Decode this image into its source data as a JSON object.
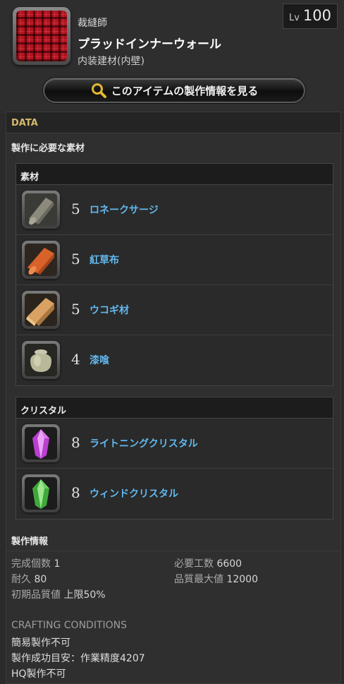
{
  "item": {
    "job": "裁縫師",
    "name": "プラッドインナーウォール",
    "category": "内装建材(内壁)",
    "level_label": "Lv",
    "level": "100",
    "icon": "red-plaid-fabric-icon"
  },
  "craft_button": {
    "label": "このアイテムの製作情報を見る",
    "icon": "magnifier-icon"
  },
  "data_section": {
    "title": "DATA",
    "materials_title": "製作に必要な素材",
    "materials_group": {
      "title": "素材",
      "items": [
        {
          "qty": "5",
          "name": "ロネークサージ",
          "icon": "cloth-roll-icon"
        },
        {
          "qty": "5",
          "name": "紅草布",
          "icon": "red-cloth-icon"
        },
        {
          "qty": "5",
          "name": "ウコギ材",
          "icon": "lumber-icon"
        },
        {
          "qty": "4",
          "name": "漆喰",
          "icon": "jar-icon"
        }
      ]
    },
    "crystals_group": {
      "title": "クリスタル",
      "items": [
        {
          "qty": "8",
          "name": "ライトニングクリスタル",
          "icon": "lightning-crystal-icon"
        },
        {
          "qty": "8",
          "name": "ウィンドクリスタル",
          "icon": "wind-crystal-icon"
        }
      ]
    },
    "craft_info": {
      "title": "製作情報",
      "yield_label": "完成個数",
      "yield": "1",
      "workload_label": "必要工数",
      "workload": "6600",
      "durability_label": "耐久",
      "durability": "80",
      "max_quality_label": "品質最大値",
      "max_quality": "12000",
      "initial_quality_label": "初期品質値",
      "initial_quality": "上限50%"
    },
    "conditions": {
      "title": "CRAFTING CONDITIONS",
      "lines": [
        "簡易製作不可",
        "製作成功目安：作業精度4207",
        "HQ製作不可"
      ]
    }
  },
  "colors": {
    "link": "#62b8ee",
    "data_header": "#d4b86a",
    "background": "#2b2b2b"
  }
}
